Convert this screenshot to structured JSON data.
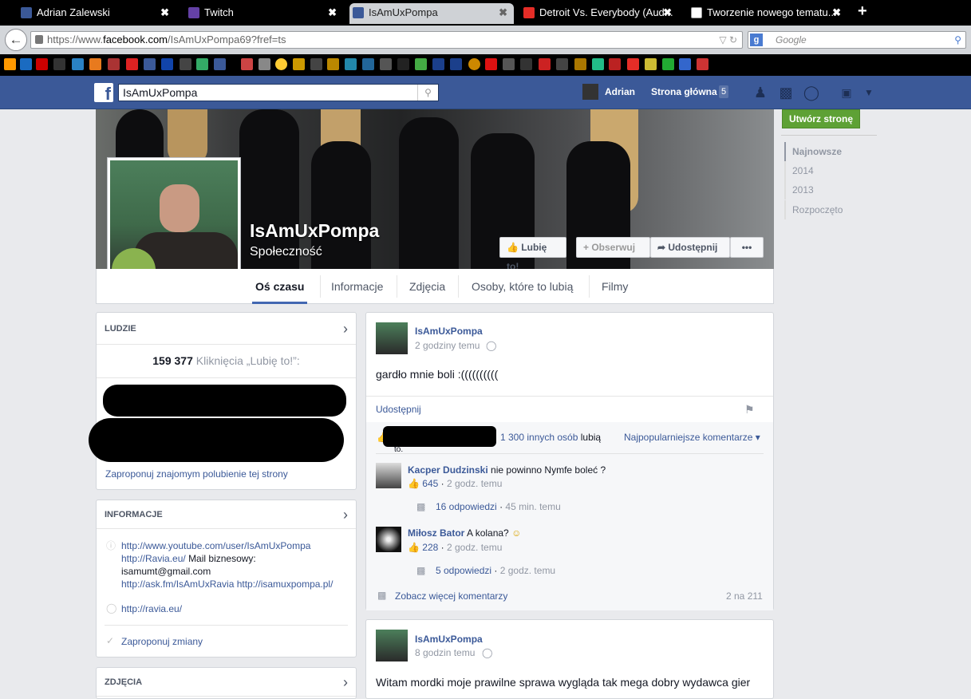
{
  "browser": {
    "tabs": [
      {
        "label": "Adrian Zalewski",
        "icon": "facebook-icon",
        "active": false
      },
      {
        "label": "Twitch",
        "icon": "twitch-icon",
        "active": false
      },
      {
        "label": "IsAmUxPompa",
        "icon": "facebook-icon",
        "active": true
      },
      {
        "label": "Detroit Vs. Everybody (Aud...",
        "icon": "youtube-icon",
        "active": false
      },
      {
        "label": "Tworzenie nowego tematu...",
        "icon": "forum-icon",
        "active": false
      }
    ],
    "close_glyph": "✖",
    "new_tab": "+",
    "url_prefix": "https://www.",
    "url_domain": "facebook.com",
    "url_rest": "/IsAmUxPompa69?fref=ts",
    "search_placeholder": "Google",
    "search_engine_letter": "g"
  },
  "fb_header": {
    "search_value": "IsAmUxPompa",
    "user_name": "Adrian",
    "home_label": "Strona główna",
    "home_count": "5"
  },
  "page": {
    "name": "IsAmUxPompa",
    "category": "Społeczność",
    "like_button": "Lubię to!",
    "follow_button": "Obserwuj",
    "share_button": "Udostępnij",
    "more_button": "•••",
    "tabs": [
      "Oś czasu",
      "Informacje",
      "Zdjęcia",
      "Osoby, które to lubią",
      "Filmy"
    ]
  },
  "right_col": {
    "create_page": "Utwórz stronę",
    "years": [
      "Najnowsze",
      "2014",
      "2013",
      "Rozpoczęto"
    ]
  },
  "people_box": {
    "title": "LUDZIE",
    "likes_count": "159 377",
    "likes_label": "Kliknięcia „Lubię to!”:",
    "suggest": "Zaproponuj znajomym polubienie tej strony"
  },
  "info_box": {
    "title": "INFORMACJE",
    "lines": [
      "http://www.youtube.com/user/IsAmUxPompa",
      "http://Ravia.eu/ Mail biznesowy:",
      "isamumt@gmail.com",
      "http://ask.fm/IsAmUxRavia http://isamuxpompa.pl/"
    ],
    "website": "http://ravia.eu/",
    "suggest_edits": "Zaproponuj zmiany"
  },
  "photos_box": {
    "title": "ZDJĘCIA"
  },
  "post1": {
    "author": "IsAmUxPompa",
    "time": "2 godziny temu",
    "text": "gardło mnie boli :((((((((((",
    "share": "Udostępnij",
    "likes_text": "1 300 innych osób",
    "likes_suffix": "lubią",
    "likes_to": "to.",
    "sort": "Najpopularniejsze komentarze ▾",
    "comments": [
      {
        "author": "Kacper Dudzinski",
        "text": "nie powinno Nymfe boleć ?",
        "likes": "645",
        "time": "2 godz. temu",
        "replies": "16 odpowiedzi",
        "reply_time": "45 min. temu"
      },
      {
        "author": "Miłosz Bator",
        "text": "A kolana?",
        "likes": "228",
        "time": "2 godz. temu",
        "replies": "5 odpowiedzi",
        "reply_time": "2 godz. temu"
      }
    ],
    "more_comments": "Zobacz więcej komentarzy",
    "count": "2 na 211"
  },
  "post2": {
    "author": "IsAmUxPompa",
    "time": "8 godzin temu",
    "text": "Witam mordki moje prawilne sprawa wygląda tak mega dobry wydawca gier"
  },
  "colors": {
    "fb_blue": "#3b5998",
    "green": "#5ea135"
  }
}
